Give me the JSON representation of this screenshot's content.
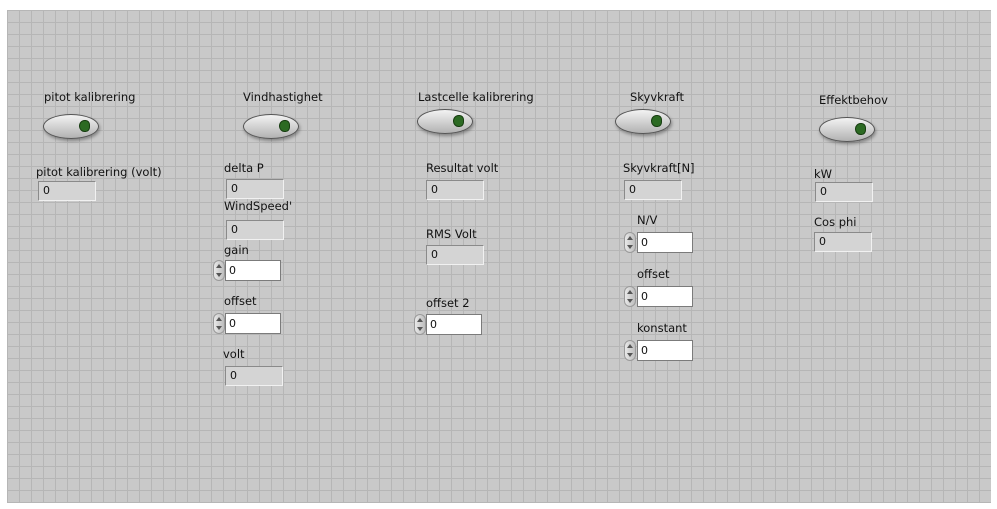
{
  "columns": {
    "pitot": {
      "button_label": "pitot kalibrering",
      "indicators": [
        {
          "label": "pitot kalibrering (volt)",
          "value": "0"
        }
      ]
    },
    "vind": {
      "button_label": "Vindhastighet",
      "delta_p": {
        "label": "delta P",
        "value": "0"
      },
      "windspeed": {
        "label": "WindSpeed'",
        "value": "0"
      },
      "gain": {
        "label": "gain",
        "value": "0"
      },
      "offset": {
        "label": "offset",
        "value": "0"
      },
      "volt": {
        "label": "volt",
        "value": "0"
      }
    },
    "lastcelle": {
      "button_label": "Lastcelle kalibrering",
      "resultat": {
        "label": "Resultat volt",
        "value": "0"
      },
      "rms": {
        "label": "RMS Volt",
        "value": "0"
      },
      "offset2": {
        "label": "offset 2",
        "value": "0"
      }
    },
    "skyvkraft": {
      "button_label": "Skyvkraft",
      "skyvkraft_n": {
        "label": "Skyvkraft[N]",
        "value": "0"
      },
      "nv": {
        "label": "N/V",
        "value": "0"
      },
      "offset": {
        "label": "offset",
        "value": "0"
      },
      "konstant": {
        "label": "konstant",
        "value": "0"
      }
    },
    "effekt": {
      "button_label": "Effektbehov",
      "kw": {
        "label": "kW",
        "value": "0"
      },
      "cosphi": {
        "label": "Cos phi",
        "value": "0"
      }
    }
  },
  "colors": {
    "panel": "#c9c9c9",
    "grid": "#b6b6b6",
    "led": "#2c6a23"
  }
}
